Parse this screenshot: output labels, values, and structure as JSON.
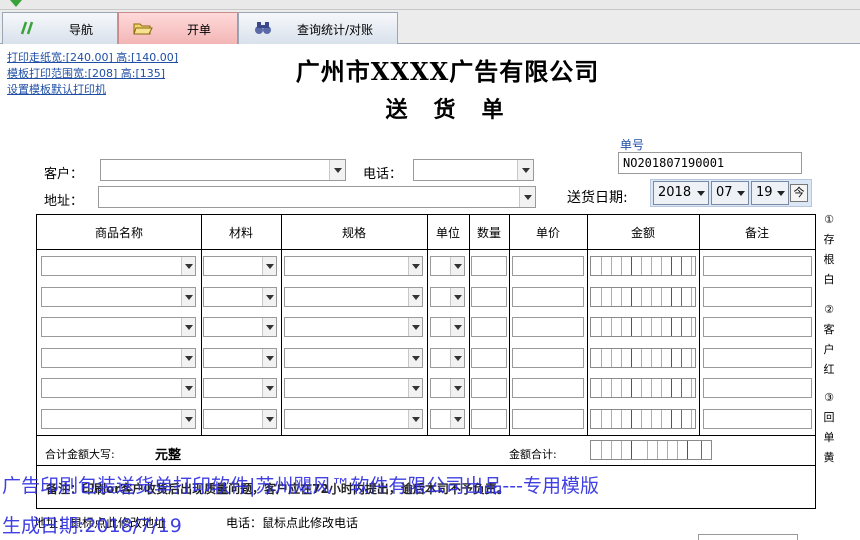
{
  "tabs": [
    {
      "label": "导航",
      "icon": "double-slash-icon"
    },
    {
      "label": "开单",
      "icon": "folder-open-icon",
      "active": true
    },
    {
      "label": "查询统计/对账",
      "icon": "binoculars-icon"
    }
  ],
  "links": {
    "print_paper": "打印走纸宽:[240.00] 高:[140.00]",
    "print_range": "模板打印范围宽:[208] 高:[135]",
    "set_printer": "设置模板默认打印机"
  },
  "company_title": "广州市XXXX广告有限公司",
  "doc_title": "送货单",
  "order": {
    "label": "单号",
    "value": "NO201807190001"
  },
  "customer": {
    "label": "客户："
  },
  "phone": {
    "label": "电话："
  },
  "address": {
    "label": "地址："
  },
  "delivery_date": {
    "label": "送货日期:",
    "year": "2018",
    "month": "07",
    "day": "19",
    "today_button": "今"
  },
  "table": {
    "headers": [
      "商品名称",
      "材料",
      "规格",
      "单位",
      "数量",
      "单价",
      "金额",
      "备注"
    ],
    "row_count": 6
  },
  "totals": {
    "amount_words_label": "合计金额大写:",
    "amount_words_value": "元整",
    "amount_total_label": "金额合计:"
  },
  "side_notes": {
    "copy1": [
      "①",
      "存",
      "根",
      "白"
    ],
    "copy2": [
      "②",
      "客",
      "户",
      "红"
    ],
    "copy3": [
      "③",
      "回",
      "单",
      "黄"
    ]
  },
  "remark": "备注：印刷or客户收货后出现质量问题，客户应在72小时内提出，逾后本司不予负责。",
  "bottom": {
    "address_hint": "地址：鼠标点此修改地址",
    "phone_hint": "电话：鼠标点此修改电话"
  },
  "watermark": {
    "line1": "广告印刷包装送货单打印软件|苏州飓风™软件有限公司出品---专用模版",
    "line2": "生成日期:2018/7/19"
  },
  "colors": {
    "link": "#1f4fa5",
    "watermark": "#2f2fe0",
    "active_tab": "#f3b6b6"
  }
}
